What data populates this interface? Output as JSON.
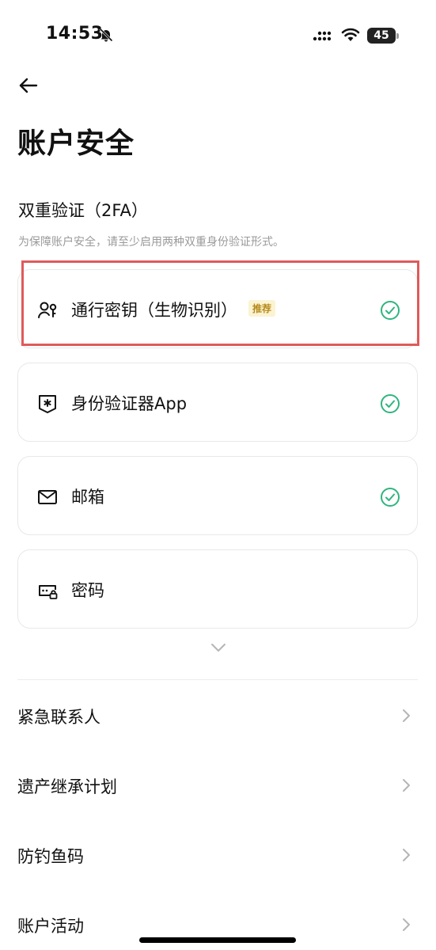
{
  "status_bar": {
    "time": "14:53",
    "battery": "45"
  },
  "header": {
    "title": "账户安全"
  },
  "twofa": {
    "title": "双重验证（2FA）",
    "description": "为保障账户安全，请至少启用两种双重身份验证形式。",
    "items": [
      {
        "label": "通行密钥（生物识别）",
        "badge": "推荐",
        "enabled": true,
        "icon": "passkey-icon"
      },
      {
        "label": "身份验证器App",
        "enabled": true,
        "icon": "authenticator-icon"
      },
      {
        "label": "邮箱",
        "enabled": true,
        "icon": "mail-icon"
      },
      {
        "label": "密码",
        "enabled": false,
        "icon": "password-icon"
      }
    ]
  },
  "menu": {
    "items": [
      {
        "label": "紧急联系人"
      },
      {
        "label": "遗产继承计划"
      },
      {
        "label": "防钓鱼码"
      },
      {
        "label": "账户活动"
      }
    ]
  },
  "colors": {
    "check_green": "#2fb57d",
    "highlight_red": "#e05a5a",
    "badge_bg": "#fbf3d1",
    "badge_text": "#b58a1c"
  }
}
